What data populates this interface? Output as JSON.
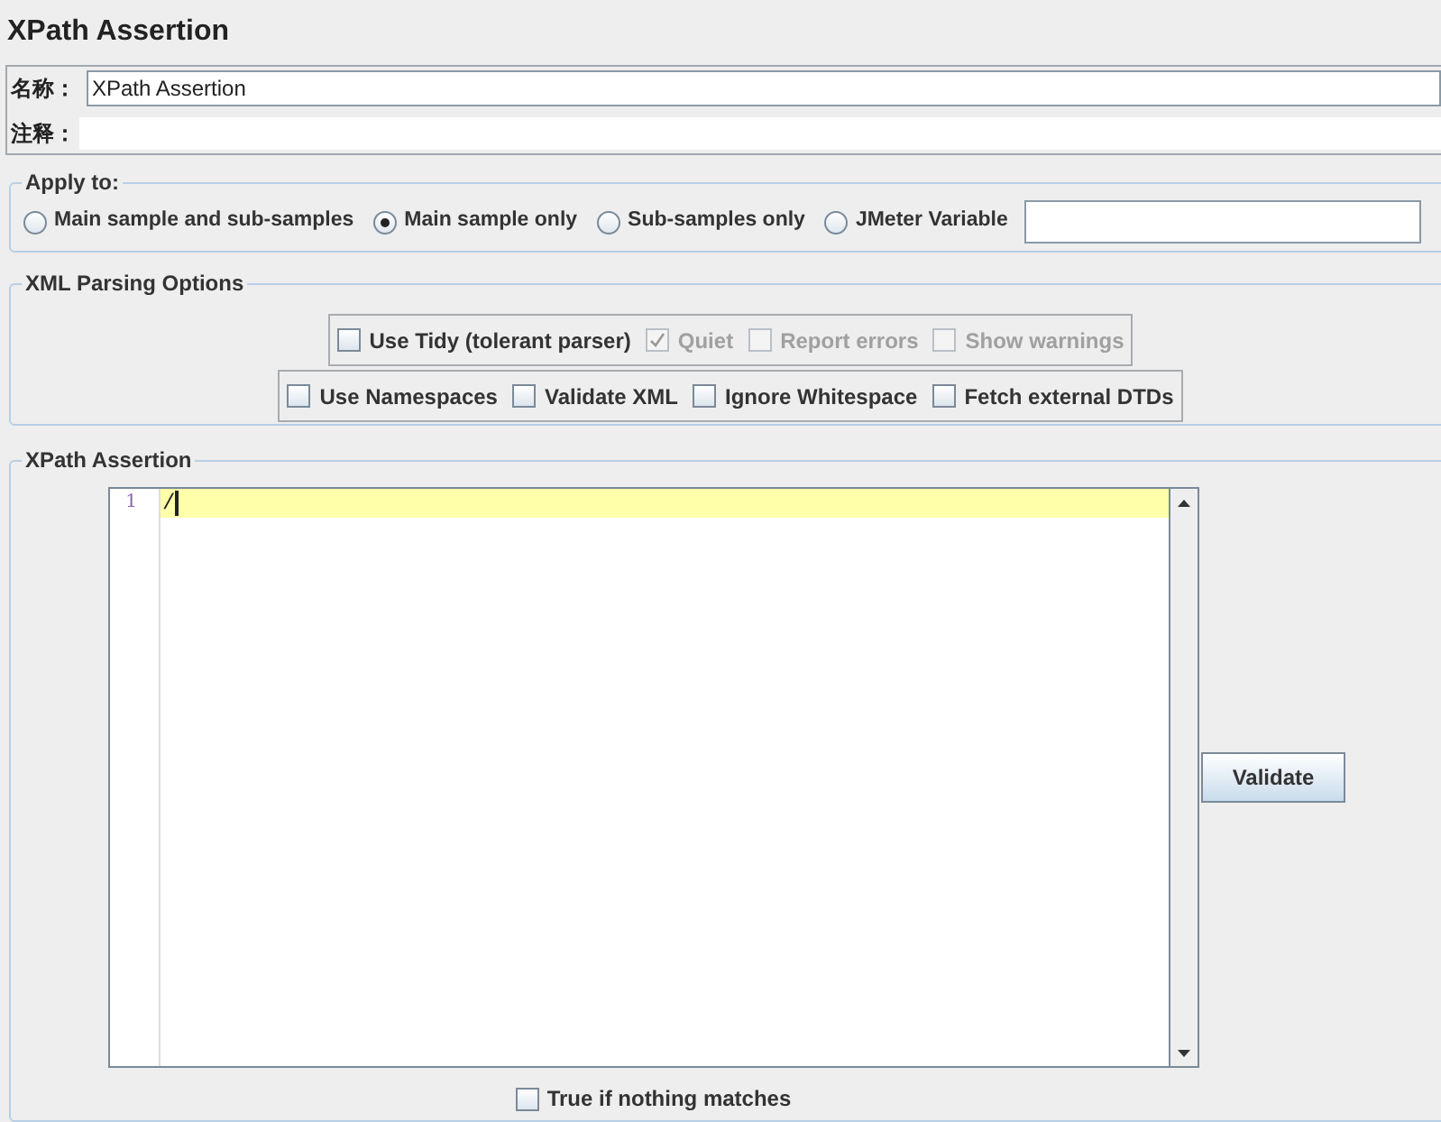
{
  "title": "XPath Assertion",
  "name_field": {
    "label": "名称：",
    "value": "XPath Assertion"
  },
  "comment_field": {
    "label": "注释："
  },
  "apply_to": {
    "title": "Apply to:",
    "options": [
      {
        "label": "Main sample and sub-samples",
        "selected": false
      },
      {
        "label": "Main sample only",
        "selected": true
      },
      {
        "label": "Sub-samples only",
        "selected": false
      },
      {
        "label": "JMeter Variable",
        "selected": false
      }
    ]
  },
  "xml_parsing": {
    "title": "XML Parsing Options",
    "panels": [
      {
        "options": [
          {
            "label": "Use Tidy (tolerant parser)",
            "checked": false,
            "disabled": false
          },
          {
            "label": "Quiet",
            "checked": true,
            "disabled": true
          },
          {
            "label": "Report errors",
            "checked": false,
            "disabled": true
          },
          {
            "label": "Show warnings",
            "checked": false,
            "disabled": true
          }
        ]
      },
      {
        "options": [
          {
            "label": "Use Namespaces",
            "checked": false,
            "disabled": false
          },
          {
            "label": "Validate XML",
            "checked": false,
            "disabled": false
          },
          {
            "label": "Ignore Whitespace",
            "checked": false,
            "disabled": false
          },
          {
            "label": "Fetch external DTDs",
            "checked": false,
            "disabled": false
          }
        ]
      }
    ]
  },
  "xpath_assertion": {
    "title": "XPath Assertion",
    "editor": {
      "lines": [
        {
          "number": "1",
          "text": "/",
          "selected": true
        }
      ]
    },
    "validate_button": "Validate",
    "negate": {
      "label": "True if nothing matches",
      "checked": false
    }
  }
}
